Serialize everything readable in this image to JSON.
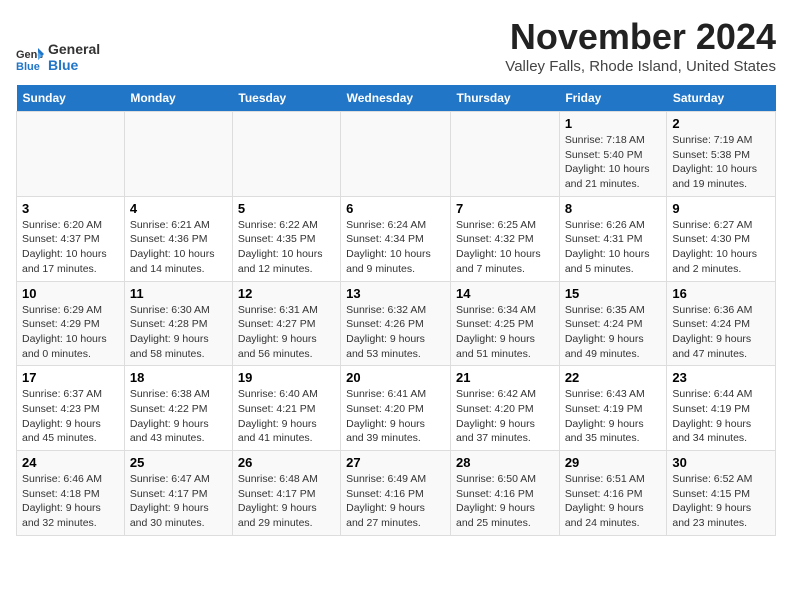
{
  "logo": {
    "line1": "General",
    "line2": "Blue"
  },
  "header": {
    "title": "November 2024",
    "subtitle": "Valley Falls, Rhode Island, United States"
  },
  "weekdays": [
    "Sunday",
    "Monday",
    "Tuesday",
    "Wednesday",
    "Thursday",
    "Friday",
    "Saturday"
  ],
  "weeks": [
    [
      {
        "day": "",
        "info": ""
      },
      {
        "day": "",
        "info": ""
      },
      {
        "day": "",
        "info": ""
      },
      {
        "day": "",
        "info": ""
      },
      {
        "day": "",
        "info": ""
      },
      {
        "day": "1",
        "info": "Sunrise: 7:18 AM\nSunset: 5:40 PM\nDaylight: 10 hours and 21 minutes."
      },
      {
        "day": "2",
        "info": "Sunrise: 7:19 AM\nSunset: 5:38 PM\nDaylight: 10 hours and 19 minutes."
      }
    ],
    [
      {
        "day": "3",
        "info": "Sunrise: 6:20 AM\nSunset: 4:37 PM\nDaylight: 10 hours and 17 minutes."
      },
      {
        "day": "4",
        "info": "Sunrise: 6:21 AM\nSunset: 4:36 PM\nDaylight: 10 hours and 14 minutes."
      },
      {
        "day": "5",
        "info": "Sunrise: 6:22 AM\nSunset: 4:35 PM\nDaylight: 10 hours and 12 minutes."
      },
      {
        "day": "6",
        "info": "Sunrise: 6:24 AM\nSunset: 4:34 PM\nDaylight: 10 hours and 9 minutes."
      },
      {
        "day": "7",
        "info": "Sunrise: 6:25 AM\nSunset: 4:32 PM\nDaylight: 10 hours and 7 minutes."
      },
      {
        "day": "8",
        "info": "Sunrise: 6:26 AM\nSunset: 4:31 PM\nDaylight: 10 hours and 5 minutes."
      },
      {
        "day": "9",
        "info": "Sunrise: 6:27 AM\nSunset: 4:30 PM\nDaylight: 10 hours and 2 minutes."
      }
    ],
    [
      {
        "day": "10",
        "info": "Sunrise: 6:29 AM\nSunset: 4:29 PM\nDaylight: 10 hours and 0 minutes."
      },
      {
        "day": "11",
        "info": "Sunrise: 6:30 AM\nSunset: 4:28 PM\nDaylight: 9 hours and 58 minutes."
      },
      {
        "day": "12",
        "info": "Sunrise: 6:31 AM\nSunset: 4:27 PM\nDaylight: 9 hours and 56 minutes."
      },
      {
        "day": "13",
        "info": "Sunrise: 6:32 AM\nSunset: 4:26 PM\nDaylight: 9 hours and 53 minutes."
      },
      {
        "day": "14",
        "info": "Sunrise: 6:34 AM\nSunset: 4:25 PM\nDaylight: 9 hours and 51 minutes."
      },
      {
        "day": "15",
        "info": "Sunrise: 6:35 AM\nSunset: 4:24 PM\nDaylight: 9 hours and 49 minutes."
      },
      {
        "day": "16",
        "info": "Sunrise: 6:36 AM\nSunset: 4:24 PM\nDaylight: 9 hours and 47 minutes."
      }
    ],
    [
      {
        "day": "17",
        "info": "Sunrise: 6:37 AM\nSunset: 4:23 PM\nDaylight: 9 hours and 45 minutes."
      },
      {
        "day": "18",
        "info": "Sunrise: 6:38 AM\nSunset: 4:22 PM\nDaylight: 9 hours and 43 minutes."
      },
      {
        "day": "19",
        "info": "Sunrise: 6:40 AM\nSunset: 4:21 PM\nDaylight: 9 hours and 41 minutes."
      },
      {
        "day": "20",
        "info": "Sunrise: 6:41 AM\nSunset: 4:20 PM\nDaylight: 9 hours and 39 minutes."
      },
      {
        "day": "21",
        "info": "Sunrise: 6:42 AM\nSunset: 4:20 PM\nDaylight: 9 hours and 37 minutes."
      },
      {
        "day": "22",
        "info": "Sunrise: 6:43 AM\nSunset: 4:19 PM\nDaylight: 9 hours and 35 minutes."
      },
      {
        "day": "23",
        "info": "Sunrise: 6:44 AM\nSunset: 4:19 PM\nDaylight: 9 hours and 34 minutes."
      }
    ],
    [
      {
        "day": "24",
        "info": "Sunrise: 6:46 AM\nSunset: 4:18 PM\nDaylight: 9 hours and 32 minutes."
      },
      {
        "day": "25",
        "info": "Sunrise: 6:47 AM\nSunset: 4:17 PM\nDaylight: 9 hours and 30 minutes."
      },
      {
        "day": "26",
        "info": "Sunrise: 6:48 AM\nSunset: 4:17 PM\nDaylight: 9 hours and 29 minutes."
      },
      {
        "day": "27",
        "info": "Sunrise: 6:49 AM\nSunset: 4:16 PM\nDaylight: 9 hours and 27 minutes."
      },
      {
        "day": "28",
        "info": "Sunrise: 6:50 AM\nSunset: 4:16 PM\nDaylight: 9 hours and 25 minutes."
      },
      {
        "day": "29",
        "info": "Sunrise: 6:51 AM\nSunset: 4:16 PM\nDaylight: 9 hours and 24 minutes."
      },
      {
        "day": "30",
        "info": "Sunrise: 6:52 AM\nSunset: 4:15 PM\nDaylight: 9 hours and 23 minutes."
      }
    ]
  ]
}
